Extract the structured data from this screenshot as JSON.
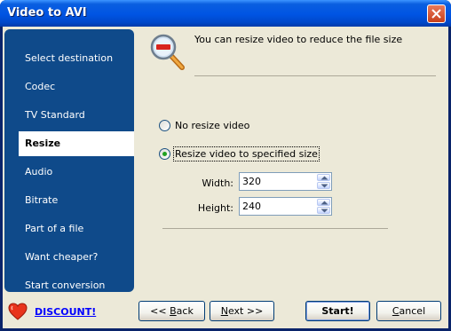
{
  "window": {
    "title": "Video to AVI"
  },
  "nav": {
    "items": [
      {
        "label": "Select destination"
      },
      {
        "label": "Codec"
      },
      {
        "label": "TV Standard"
      },
      {
        "label": "Resize",
        "active": true
      },
      {
        "label": "Audio"
      },
      {
        "label": "Bitrate"
      },
      {
        "label": "Part of a file"
      },
      {
        "label": "Want cheaper?"
      },
      {
        "label": "Start conversion"
      }
    ]
  },
  "header": {
    "text": "You can resize video to reduce the file size",
    "icon": "magnifier-minus-icon"
  },
  "options": {
    "no_resize": {
      "label": "No resize video",
      "selected": false
    },
    "resize_specified": {
      "label": "Resize video to specified size",
      "selected": true
    }
  },
  "fields": {
    "width": {
      "label": "Width:",
      "value": "320"
    },
    "height": {
      "label": "Height:",
      "value": "240"
    }
  },
  "footer": {
    "discount_label": "DISCOUNT!",
    "back_prefix": "<< ",
    "back_accel": "B",
    "back_rest": "ack",
    "next_accel": "N",
    "next_rest": "ext >>",
    "start_label": "Start!",
    "cancel_accel": "C",
    "cancel_rest": "ancel"
  },
  "colors": {
    "nav_bg": "#0f4a8a",
    "titlebar": "#0054e3",
    "face": "#ece9d8",
    "link": "#0000ff"
  }
}
